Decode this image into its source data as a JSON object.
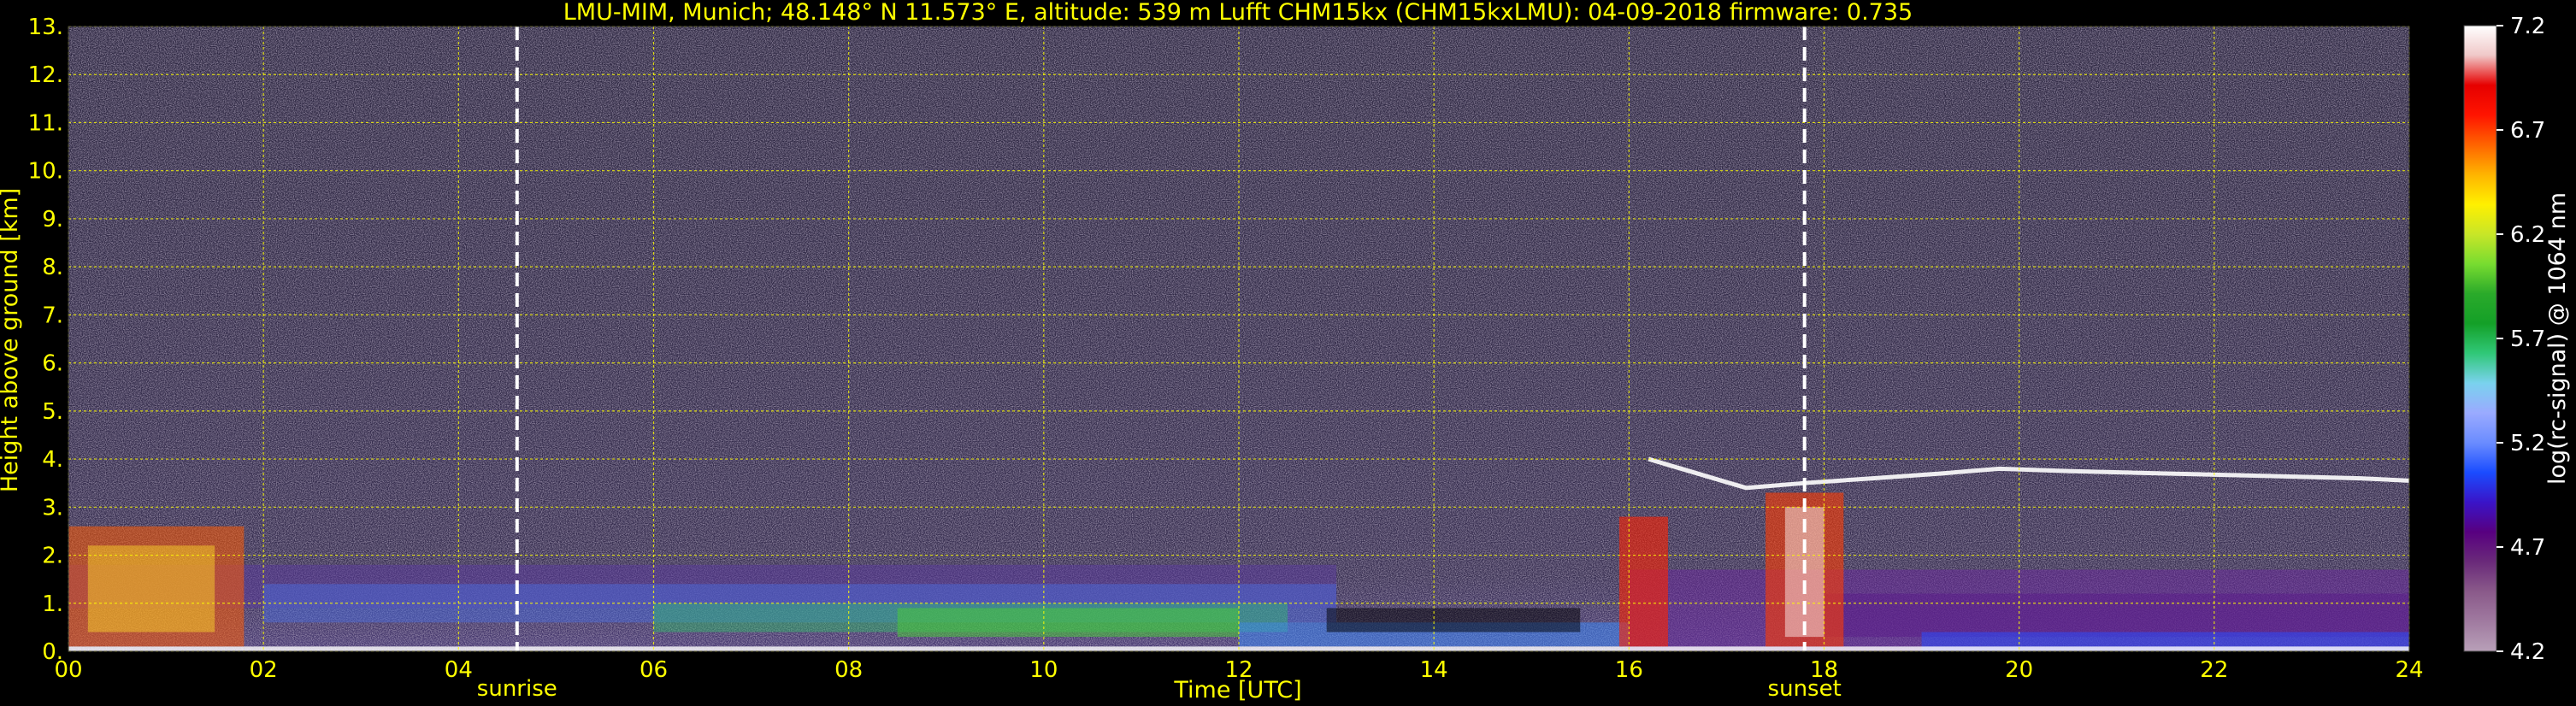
{
  "chart_data": {
    "type": "heatmap",
    "title": "LMU-MIM, Munich; 48.148° N 11.573° E, altitude: 539 m    Lufft CHM15kx (CHM15kxLMU): 04-09-2018    firmware: 0.735",
    "xlabel": "Time [UTC]",
    "ylabel": "Height above ground [km]",
    "xlim": [
      0,
      24
    ],
    "ylim": [
      0,
      13
    ],
    "x_ticks": [
      "00",
      "02",
      "04",
      "06",
      "08",
      "10",
      "12",
      "14",
      "16",
      "18",
      "20",
      "22",
      "24"
    ],
    "y_ticks": [
      "0.",
      "1.",
      "2.",
      "3.",
      "4.",
      "5.",
      "6.",
      "7.",
      "8.",
      "9.",
      "10.",
      "11.",
      "12.",
      "13."
    ],
    "grid": true,
    "markers": [
      {
        "label": "sunrise",
        "x": 4.6
      },
      {
        "label": "sunset",
        "x": 17.8
      }
    ],
    "colorbar": {
      "label": "log(rc-signal) @ 1064 nm",
      "range": [
        4.2,
        7.2
      ],
      "ticks": [
        "7.2",
        "6.7",
        "6.2",
        "5.7",
        "5.2",
        "4.7",
        "4.2"
      ],
      "colors": [
        "#b8a0b8",
        "#a07aa0",
        "#8a5a8a",
        "#6a2a7a",
        "#580080",
        "#3a14c8",
        "#1a4cff",
        "#6a8cff",
        "#9aaaff",
        "#7ad2ee",
        "#30c878",
        "#14a028",
        "#2aaa2a",
        "#78dc30",
        "#c8e628",
        "#fff000",
        "#ffb400",
        "#ff6400",
        "#ff1400",
        "#e60000",
        "#f0c8c8",
        "#ffffff"
      ]
    },
    "features": {
      "boundary_layer_km_start": 1.5,
      "cloud_layer_evening_km": 3.6
    },
    "colors": {
      "axis_text": "#ffff00",
      "grid": "#ffff00",
      "marker_line": "#ffffff",
      "colorbar_text": "#ffffff"
    }
  }
}
